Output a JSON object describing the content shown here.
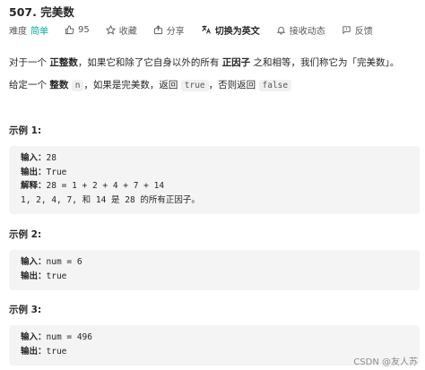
{
  "problem": {
    "title": "507. 完美数",
    "difficulty_label": "难度",
    "difficulty_value": "简单",
    "likes": "95",
    "collect_label": "收藏",
    "share_label": "分享",
    "translate_label": "切换为英文",
    "notify_label": "接收动态",
    "feedback_label": "反馈"
  },
  "description": {
    "line1_pre": "对于一个 ",
    "line1_b1": "正整数",
    "line1_mid": "，如果它和除了它自身以外的所有 ",
    "line1_b2": "正因子",
    "line1_post": " 之和相等，我们称它为「完美数」。",
    "line2_pre": "给定一个 ",
    "line2_b": "整数",
    "line2_code1": "n",
    "line2_mid": "，如果是完美数，返回 ",
    "line2_code2": "true",
    "line2_mid2": "，否则返回 ",
    "line2_code3": "false"
  },
  "examples": [
    {
      "title": "示例 1:",
      "input_key": "输入：",
      "input_val": "28",
      "output_key": "输出：",
      "output_val": "True",
      "explain_key": "解释：",
      "explain_val": "28 = 1 + 2 + 4 + 7 + 14",
      "explain_line2": "1, 2, 4, 7, 和 14 是 28 的所有正因子。"
    },
    {
      "title": "示例 2:",
      "input_key": "输入：",
      "input_val": "num = 6",
      "output_key": "输出：",
      "output_val": "true"
    },
    {
      "title": "示例 3:",
      "input_key": "输入：",
      "input_val": "num = 496",
      "output_key": "输出：",
      "output_val": "true"
    }
  ],
  "watermark": "CSDN @友人苏",
  "colors": {
    "difficulty_easy": "#00af9b",
    "code_bg": "#f4f4f4"
  },
  "icons": {
    "like": "thumbs-up-icon",
    "collect": "star-icon",
    "share": "share-icon",
    "translate": "translate-icon",
    "notify": "bell-icon",
    "feedback": "feedback-icon"
  }
}
